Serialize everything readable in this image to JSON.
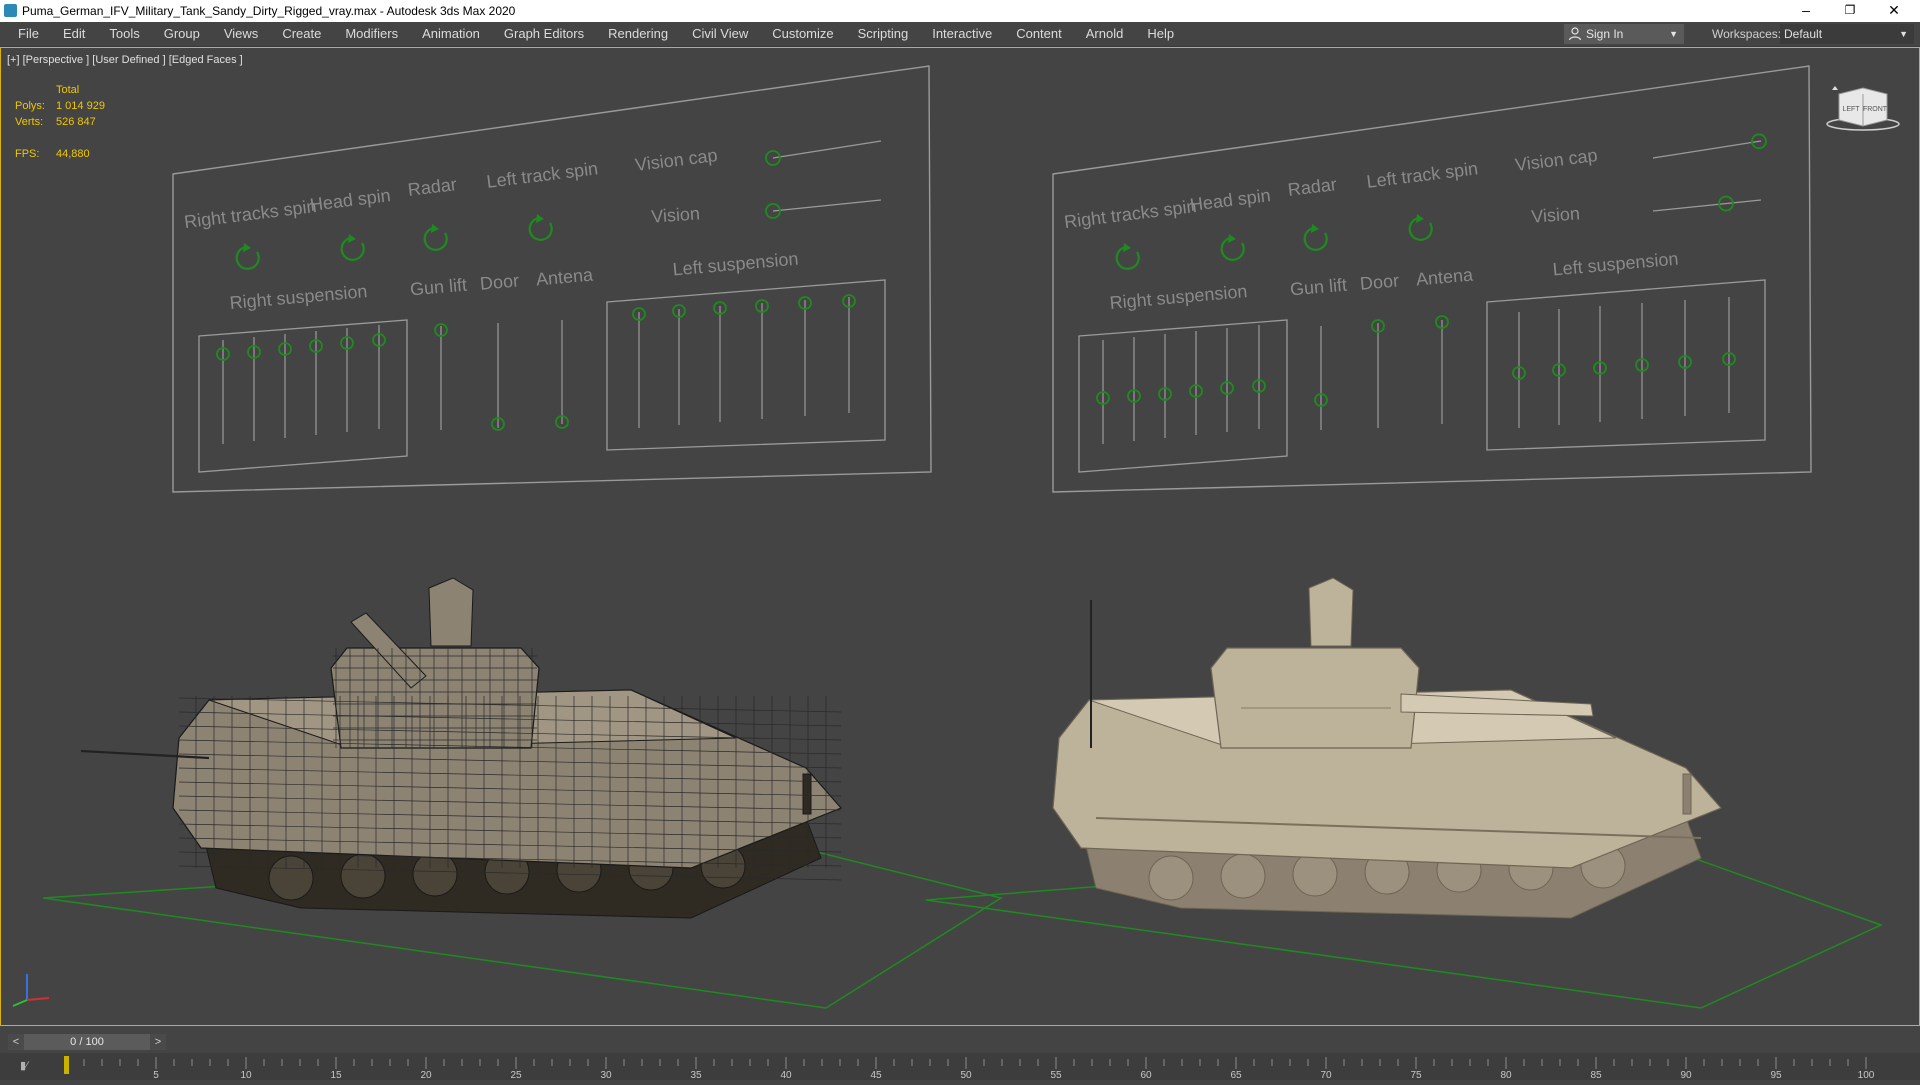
{
  "window": {
    "title": "Puma_German_IFV_Military_Tank_Sandy_Dirty_Rigged_vray.max - Autodesk 3ds Max 2020",
    "minimize": "–",
    "restore": "❐",
    "close": "✕"
  },
  "menu": {
    "items": [
      "File",
      "Edit",
      "Tools",
      "Group",
      "Views",
      "Create",
      "Modifiers",
      "Animation",
      "Graph Editors",
      "Rendering",
      "Civil View",
      "Customize",
      "Scripting",
      "Interactive",
      "Content",
      "Arnold",
      "Help"
    ],
    "sign_in": "Sign In",
    "workspaces_label": "Workspaces:",
    "workspaces_value": "Default"
  },
  "viewport": {
    "label": "[+] [Perspective ] [User Defined ] [Edged Faces ]",
    "stats": {
      "total": "Total",
      "polys_label": "Polys:",
      "polys_value": "1 014 929",
      "verts_label": "Verts:",
      "verts_value": "526 847",
      "fps_label": "FPS:",
      "fps_value": "44,880"
    },
    "viewcube": {
      "left": "LEFT",
      "front": "FRONT"
    }
  },
  "panel_labels": {
    "right_tracks_spin": "Right tracks spin",
    "head_spin": "Head spin",
    "radar": "Radar",
    "left_track_spin": "Left track spin",
    "vision_cap": "Vision cap",
    "vision": "Vision",
    "right_suspension": "Right suspension",
    "gun_lift": "Gun lift",
    "door": "Door",
    "antena": "Antena",
    "left_suspension": "Left suspension"
  },
  "timeline": {
    "prev": "<",
    "next": ">",
    "frame_label": "0 / 100",
    "ticks": [
      "5",
      "10",
      "15",
      "20",
      "25",
      "30",
      "35",
      "40",
      "45",
      "50",
      "55",
      "60",
      "65",
      "70",
      "75",
      "80",
      "85",
      "90",
      "95",
      "100"
    ]
  },
  "colors": {
    "viewport_bg": "#444444",
    "active_border": "#d9b300",
    "stat_text": "#f0c700",
    "control_green": "#1f8a1f",
    "panel_line": "#9a9a9a"
  }
}
